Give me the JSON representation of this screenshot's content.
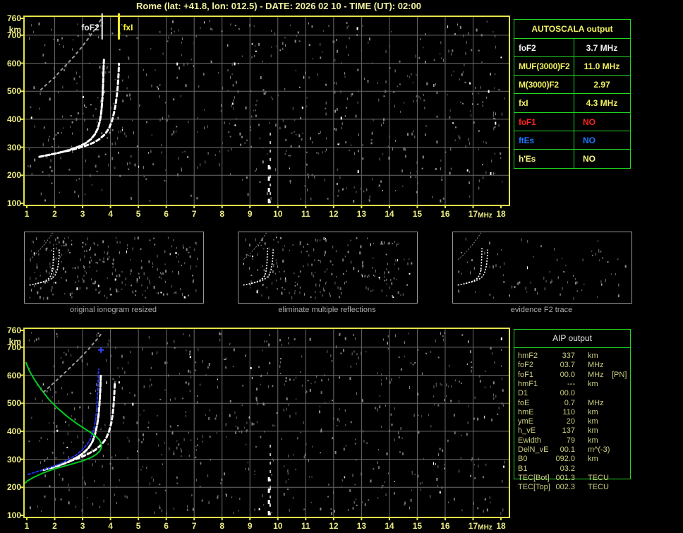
{
  "title": "Rome (lat: +41.8, lon: 012.5) - DATE: 2026 02 10 - TIME (UT): 02:00",
  "colors": {
    "accent_yellow": "#F0F060",
    "axis_label": "#ECEC84",
    "plot_border": "#E2E24A",
    "grid": "#6A6A6A",
    "table_border": "#22D822",
    "trace_white": "#FFFFFF",
    "profile_green": "#00CC22",
    "restored_blue": "#2233EE",
    "status_red": "#FF2222",
    "status_blue": "#1E78FF"
  },
  "autoscala_table": {
    "header": "AUTOSCALA output",
    "rows": [
      {
        "label": "foF2",
        "value": "3.7 MHz",
        "color": "#F0F0F0"
      },
      {
        "label": "MUF(3000)F2",
        "value": "11.0 MHz",
        "color": "#F0F060"
      },
      {
        "label": "M(3000)F2",
        "value": "2.97",
        "color": "#F0F060"
      },
      {
        "label": "fxI",
        "value": "4.3 MHz",
        "color": "#F0F060"
      },
      {
        "label": "foF1",
        "value": "NO",
        "color": "#FF2222"
      },
      {
        "label": "ftEs",
        "value": "NO",
        "color": "#1E78FF"
      },
      {
        "label": "h'Es",
        "value": "NO",
        "color": "#F5F580"
      }
    ]
  },
  "aip_table": {
    "header": "AIP output",
    "rows": [
      {
        "name": "hmF2",
        "value": "337",
        "unit": "km",
        "note": ""
      },
      {
        "name": "foF2",
        "value": "03.7",
        "unit": "MHz",
        "note": ""
      },
      {
        "name": "foF1",
        "value": "00.0",
        "unit": "MHz",
        "note": "[PN]"
      },
      {
        "name": "hmF1",
        "value": "---",
        "unit": "km",
        "note": ""
      },
      {
        "name": "D1",
        "value": "00.0",
        "unit": "",
        "note": ""
      },
      {
        "name": "foE",
        "value": "0.7",
        "unit": "MHz",
        "note": ""
      },
      {
        "name": "hmE",
        "value": "110",
        "unit": "km",
        "note": ""
      },
      {
        "name": "ymE",
        "value": "20",
        "unit": "km",
        "note": ""
      },
      {
        "name": "h_vE",
        "value": "137",
        "unit": "km",
        "note": ""
      },
      {
        "name": "Ewidth",
        "value": "79",
        "unit": "km",
        "note": ""
      },
      {
        "name": "DelN_vE",
        "value": "00.1",
        "unit": "m^(-3)",
        "note": ""
      },
      {
        "name": "B0",
        "value": "092.0",
        "unit": "km",
        "note": ""
      },
      {
        "name": "B1",
        "value": "03.2",
        "unit": "",
        "note": ""
      },
      {
        "name": "TEC[Bot]",
        "value": "001.3",
        "unit": "TECU",
        "note": ""
      },
      {
        "name": "TEC[Top]",
        "value": "002.3",
        "unit": "TECU",
        "note": ""
      }
    ]
  },
  "thumbnails": [
    {
      "caption": "original ionogram resized",
      "noise_count": 260,
      "noise_seed": 11
    },
    {
      "caption": "eliminate multiple reflections",
      "noise_count": 210,
      "noise_seed": 22
    },
    {
      "caption": "evidence F2 trace",
      "noise_count": 85,
      "noise_seed": 33
    }
  ],
  "chart_data": [
    {
      "id": "top-ionogram",
      "type": "scatter",
      "title": "autoscaled ionogram with foF2 and fxI markers",
      "xlabel": "MHz",
      "ylabel": "km",
      "xlim": [
        1,
        18
      ],
      "ylim": [
        100,
        760
      ],
      "xticks": [
        1,
        2,
        3,
        4,
        5,
        6,
        7,
        8,
        9,
        10,
        11,
        12,
        13,
        14,
        15,
        16,
        17,
        18
      ],
      "yticks": [
        760,
        700,
        600,
        500,
        400,
        300,
        200,
        100
      ],
      "grid": true,
      "noise": {
        "seed": 7,
        "count": 680
      },
      "markers": [
        {
          "name": "foF2",
          "label": "foF2",
          "freq": 3.7,
          "color": "#F0F0F0",
          "label_side": "left"
        },
        {
          "name": "fxI",
          "label": "fxI",
          "freq": 4.3,
          "color": "#F5F530",
          "label_side": "right"
        }
      ],
      "series": [
        {
          "name": "F2-O-trace",
          "color": "#FFFFFF",
          "width": 3,
          "dash": "6 3",
          "points": [
            [
              1.45,
              266
            ],
            [
              1.7,
              271
            ],
            [
              2.0,
              277
            ],
            [
              2.3,
              284
            ],
            [
              2.6,
              293
            ],
            [
              2.9,
              304
            ],
            [
              3.1,
              314
            ],
            [
              3.3,
              329
            ],
            [
              3.45,
              347
            ],
            [
              3.55,
              368
            ],
            [
              3.62,
              394
            ],
            [
              3.67,
              424
            ],
            [
              3.7,
              458
            ],
            [
              3.72,
              492
            ],
            [
              3.735,
              526
            ],
            [
              3.745,
              558
            ],
            [
              3.755,
              588
            ],
            [
              3.765,
              612
            ]
          ]
        },
        {
          "name": "F2-X-trace",
          "color": "#FFFFFF",
          "width": 3,
          "dash": "5 4",
          "points": [
            [
              2.2,
              282
            ],
            [
              2.5,
              288
            ],
            [
              2.8,
              296
            ],
            [
              3.1,
              305
            ],
            [
              3.4,
              317
            ],
            [
              3.6,
              329
            ],
            [
              3.8,
              346
            ],
            [
              3.95,
              368
            ],
            [
              4.05,
              394
            ],
            [
              4.13,
              424
            ],
            [
              4.19,
              456
            ],
            [
              4.23,
              488
            ],
            [
              4.26,
              518
            ],
            [
              4.28,
              548
            ],
            [
              4.295,
              576
            ],
            [
              4.305,
              598
            ]
          ]
        },
        {
          "name": "second-hop-trace",
          "color": "#9A9A9A",
          "width": 2,
          "dash": "3 5",
          "points": [
            [
              1.5,
              505
            ],
            [
              1.75,
              528
            ],
            [
              2.0,
              550
            ],
            [
              2.2,
              572
            ],
            [
              2.45,
              598
            ],
            [
              2.7,
              625
            ],
            [
              2.95,
              655
            ],
            [
              3.2,
              688
            ],
            [
              3.45,
              722
            ],
            [
              3.65,
              755
            ]
          ]
        },
        {
          "name": "interference-streak",
          "type": "vline",
          "freq": 9.73,
          "from": 100,
          "to": 360,
          "color": "#BBBBBB",
          "width": 2,
          "dash": "4 8"
        },
        {
          "name": "interference-streak-bright",
          "type": "vline",
          "freq": 9.68,
          "from": 100,
          "to": 250,
          "color": "#FFFFFF",
          "width": 3,
          "dash": "6 10"
        }
      ]
    },
    {
      "id": "bottom-ionogram",
      "type": "scatter",
      "title": "restored trace and electron density profile",
      "xlabel": "MHz",
      "ylabel": "km",
      "xlim": [
        1,
        18
      ],
      "ylim": [
        100,
        760
      ],
      "xticks": [
        1,
        2,
        3,
        4,
        5,
        6,
        7,
        8,
        9,
        10,
        11,
        12,
        13,
        14,
        15,
        16,
        17,
        18
      ],
      "yticks": [
        760,
        700,
        600,
        500,
        400,
        300,
        200,
        100
      ],
      "grid": true,
      "noise": {
        "seed": 19,
        "count": 680
      },
      "markers": [
        {
          "name": "restored-top-point",
          "type": "plus",
          "x": 3.66,
          "y": 690,
          "color": "#3344FF"
        }
      ],
      "series": [
        {
          "name": "F2-O-trace",
          "color": "#FFFFFF",
          "width": 3,
          "dash": "6 3",
          "points": [
            [
              1.6,
              262
            ],
            [
              1.9,
              270
            ],
            [
              2.2,
              279
            ],
            [
              2.5,
              291
            ],
            [
              2.75,
              304
            ],
            [
              3.0,
              320
            ],
            [
              3.2,
              339
            ],
            [
              3.35,
              362
            ],
            [
              3.45,
              390
            ],
            [
              3.52,
              422
            ],
            [
              3.57,
              456
            ],
            [
              3.6,
              490
            ],
            [
              3.62,
              522
            ],
            [
              3.635,
              552
            ],
            [
              3.645,
              580
            ],
            [
              3.655,
              605
            ]
          ]
        },
        {
          "name": "F2-X-trace",
          "color": "#FFFFFF",
          "width": 3,
          "dash": "5 4",
          "points": [
            [
              2.55,
              294
            ],
            [
              2.85,
              304
            ],
            [
              3.15,
              317
            ],
            [
              3.45,
              333
            ],
            [
              3.68,
              352
            ],
            [
              3.84,
              374
            ],
            [
              3.95,
              400
            ],
            [
              4.03,
              430
            ],
            [
              4.08,
              462
            ],
            [
              4.11,
              492
            ],
            [
              4.13,
              520
            ],
            [
              4.145,
              548
            ],
            [
              4.155,
              570
            ]
          ]
        },
        {
          "name": "restored-trace",
          "color": "#2233EE",
          "width": 2,
          "dash": "3 3",
          "points": [
            [
              1.05,
              246
            ],
            [
              1.3,
              254
            ],
            [
              1.6,
              263
            ],
            [
              1.9,
              273
            ],
            [
              2.2,
              285
            ],
            [
              2.5,
              299
            ],
            [
              2.75,
              314
            ],
            [
              2.95,
              330
            ],
            [
              3.1,
              346
            ],
            [
              3.25,
              366
            ],
            [
              3.35,
              390
            ],
            [
              3.42,
              416
            ],
            [
              3.47,
              444
            ],
            [
              3.5,
              472
            ],
            [
              3.52,
              500
            ],
            [
              3.535,
              528
            ],
            [
              3.55,
              556
            ],
            [
              3.56,
              582
            ],
            [
              3.57,
              608
            ],
            [
              3.575,
              622
            ]
          ]
        },
        {
          "name": "electron-density-profile",
          "color": "#00CC22",
          "width": 2,
          "dash": "",
          "points": [
            [
              0.97,
              645
            ],
            [
              1.1,
              614
            ],
            [
              1.3,
              580
            ],
            [
              1.55,
              545
            ],
            [
              1.8,
              513
            ],
            [
              2.1,
              483
            ],
            [
              2.4,
              457
            ],
            [
              2.7,
              434
            ],
            [
              3.0,
              414
            ],
            [
              3.25,
              398
            ],
            [
              3.45,
              384
            ],
            [
              3.6,
              370
            ],
            [
              3.67,
              356
            ],
            [
              3.68,
              344
            ],
            [
              3.62,
              330
            ],
            [
              3.5,
              318
            ],
            [
              3.3,
              306
            ],
            [
              3.05,
              296
            ],
            [
              2.75,
              287
            ],
            [
              2.4,
              277
            ],
            [
              2.0,
              266
            ],
            [
              1.6,
              252
            ],
            [
              1.25,
              236
            ],
            [
              1.0,
              222
            ],
            [
              0.95,
              216
            ]
          ]
        },
        {
          "name": "second-hop-trace",
          "color": "#9A9A9A",
          "width": 2,
          "dash": "3 5",
          "points": [
            [
              1.6,
              540
            ],
            [
              1.85,
              562
            ],
            [
              2.1,
              585
            ],
            [
              2.35,
              608
            ],
            [
              2.6,
              632
            ],
            [
              2.9,
              660
            ],
            [
              3.2,
              692
            ],
            [
              3.5,
              726
            ],
            [
              3.7,
              752
            ]
          ]
        },
        {
          "name": "interference-streak",
          "type": "vline",
          "freq": 9.73,
          "from": 100,
          "to": 355,
          "color": "#BBBBBB",
          "width": 2,
          "dash": "4 8"
        },
        {
          "name": "interference-streak-bright",
          "type": "vline",
          "freq": 9.68,
          "from": 100,
          "to": 240,
          "color": "#FFFFFF",
          "width": 3,
          "dash": "6 10"
        }
      ]
    }
  ]
}
